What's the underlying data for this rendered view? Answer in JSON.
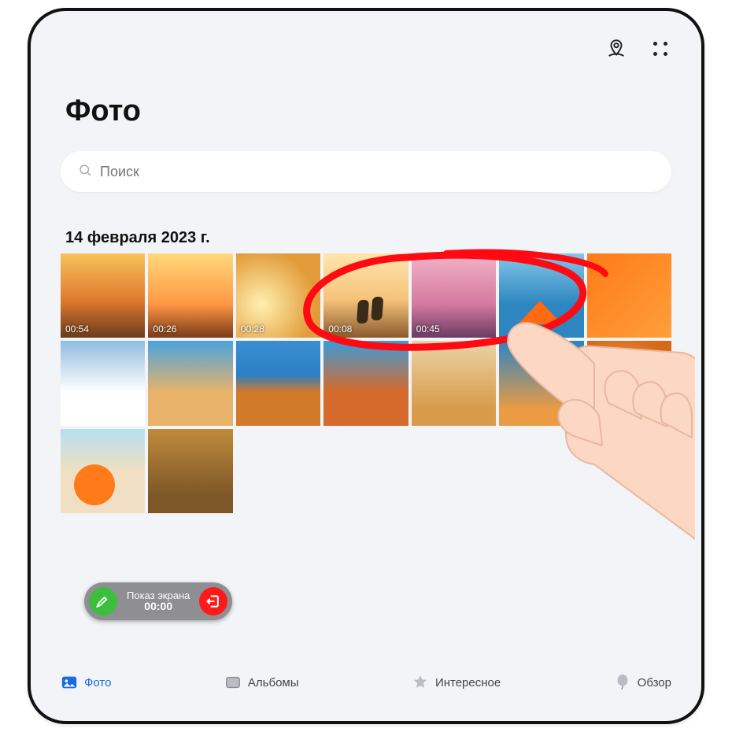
{
  "header": {
    "title": "Фото"
  },
  "search": {
    "placeholder": "Поиск"
  },
  "section": {
    "date": "14 февраля 2023 г."
  },
  "thumbs": {
    "row1": [
      {
        "duration": "00:54",
        "kind": "sunset"
      },
      {
        "duration": "00:26",
        "kind": "palm"
      },
      {
        "duration": "00:28",
        "kind": "wheat"
      },
      {
        "duration": "00:08",
        "kind": "silh"
      },
      {
        "duration": "00:45",
        "kind": "pink"
      },
      {
        "duration": "",
        "kind": "boat"
      },
      {
        "duration": "",
        "kind": "flat"
      }
    ],
    "row2": [
      {
        "kind": "ski"
      },
      {
        "kind": "camel"
      },
      {
        "kind": "houses"
      },
      {
        "kind": "arch"
      },
      {
        "kind": "chairs"
      },
      {
        "kind": "blue"
      },
      {
        "kind": "dune"
      }
    ],
    "row3": [
      {
        "kind": "orange"
      },
      {
        "kind": "tent"
      }
    ]
  },
  "screenshare": {
    "title": "Показ экрана",
    "time": "00:00"
  },
  "tabs": {
    "photos": {
      "label": "Фото",
      "active": true
    },
    "albums": {
      "label": "Альбомы",
      "active": false
    },
    "highlights": {
      "label": "Интересное",
      "active": false
    },
    "overview": {
      "label": "Обзор",
      "active": false
    }
  },
  "colors": {
    "accent": "#1a6be8",
    "annotation": "#ff0a12",
    "pill_bg": "#8e8e93",
    "pill_green": "#3cbf3c",
    "pill_red": "#ff1a1a"
  }
}
